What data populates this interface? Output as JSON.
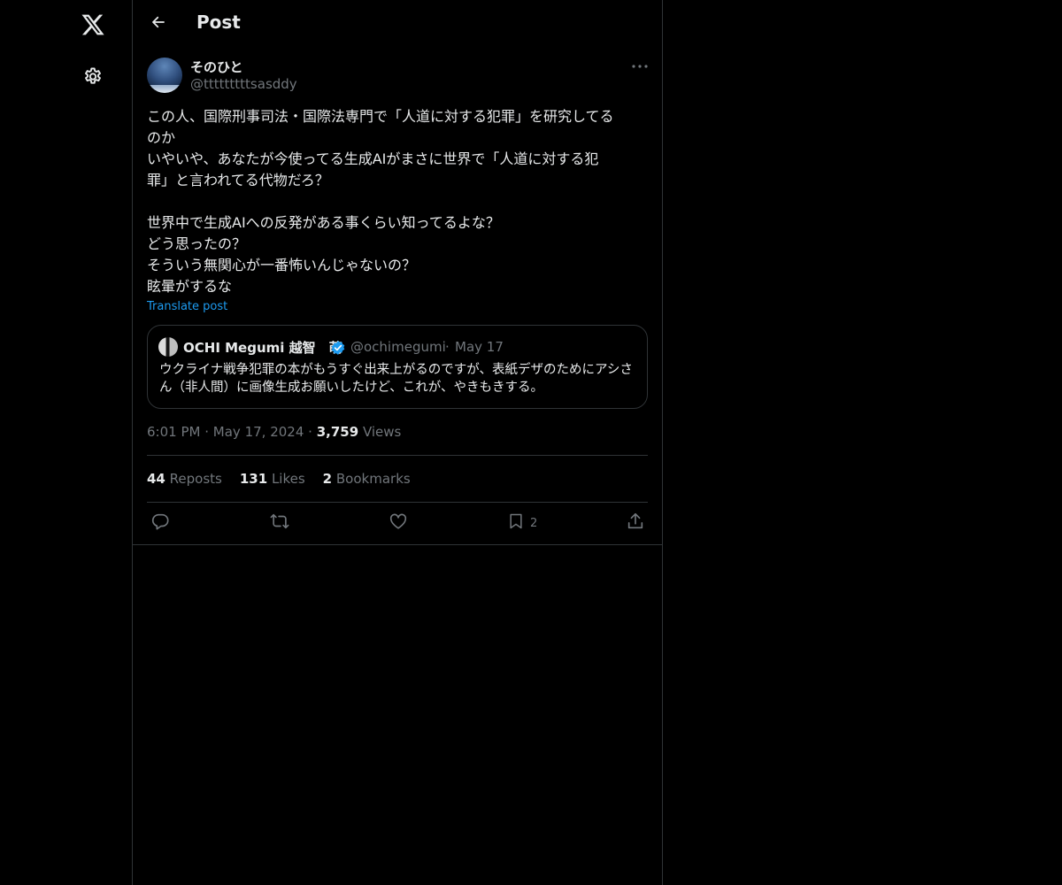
{
  "header": {
    "title": "Post"
  },
  "post": {
    "display_name": "そのひと",
    "handle": "@tttttttttsasddy",
    "text": "この人、国際刑事司法・国際法専門で「人道に対する犯罪」を研究してる\nのか\nいやいや、あなたが今使ってる生成AIがまさに世界で「人道に対する犯\n罪」と言われてる代物だろ？\n\n世界中で生成AIへの反発がある事くらい知ってるよな？\nどう思ったの？\nそういう無関心が一番怖いんじゃないの？\n眩暈がするな",
    "translate_label": "Translate post",
    "time": "6:01 PM",
    "date": "May 17, 2024",
    "views_count": "3,759",
    "views_label": "Views",
    "reposts_count": "44",
    "reposts_label": "Reposts",
    "likes_count": "131",
    "likes_label": "Likes",
    "bookmarks_count": "2",
    "bookmarks_label": "Bookmarks",
    "bookmark_action_count": "2"
  },
  "quote": {
    "name": "OCHI Megumi 越智　萌",
    "handle": "@ochimegumi",
    "date": "May 17",
    "text": "ウクライナ戦争犯罪の本がもうすぐ出来上がるのですが、表紙デザのためにアシさん（非人間）に画像生成お願いしたけど、これが、やきもきする。"
  },
  "separator": "·",
  "icons": {
    "logo": "x-logo-icon",
    "settings": "gear-icon",
    "back": "arrow-left-icon",
    "more": "more-horizontal-icon",
    "verified": "verified-badge-icon",
    "reply": "reply-icon",
    "repost": "repost-icon",
    "like": "heart-icon",
    "bookmark": "bookmark-icon",
    "share": "share-icon"
  },
  "colors": {
    "background": "#000000",
    "text": "#e7e9ea",
    "secondary": "#71767b",
    "border": "#2f3336",
    "link": "#1d9bf0",
    "verified": "#1d9bf0"
  }
}
